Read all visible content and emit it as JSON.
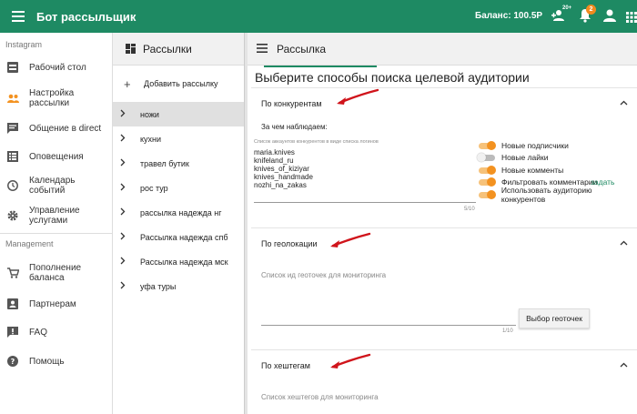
{
  "app": {
    "title": "Бот рассыльщик",
    "balance": "Баланс: 100.5Р",
    "notifications_count": "2",
    "add_user_badge": "20+"
  },
  "sidebar": {
    "section_instagram": "Instagram",
    "items": [
      {
        "label": "Рабочий стол",
        "icon": "dashboard-icon"
      },
      {
        "label": "Настройка рассылки",
        "icon": "people-icon"
      },
      {
        "label": "Общение в direct",
        "icon": "chat-icon"
      },
      {
        "label": "Оповещения",
        "icon": "notification-list-icon"
      },
      {
        "label": "Календарь событий",
        "icon": "clock-icon"
      },
      {
        "label": "Управление услугами",
        "icon": "gear-icon"
      }
    ],
    "section_management": "Management",
    "mgmt_items": [
      {
        "label": "Пополнение баланса",
        "icon": "cart-icon"
      },
      {
        "label": "Партнерам",
        "icon": "contact-icon"
      },
      {
        "label": "FAQ",
        "icon": "faq-icon"
      },
      {
        "label": "Помощь",
        "icon": "help-icon"
      }
    ]
  },
  "mailings": {
    "header": "Рассылки",
    "add_label": "Добавить рассылку",
    "items": [
      "ножи",
      "кухни",
      "травел бутик",
      "рос тур",
      "рассылка надежда нг",
      "Рассылка надежда спб",
      "Рассылка надежда мск",
      "уфа туры"
    ],
    "selected_index": 0
  },
  "main": {
    "header": "Рассылка",
    "title": "Выберите способы поиска целевой аудитории",
    "competitors": {
      "title": "По конкурентам",
      "watch_label": "За чем наблюдаем:",
      "list_hint": "Список аккаунтов конкурентов в виде списка логинов",
      "accounts": "maria.knives\nknifeland_ru\nknives_of_kiziyar\nknives_handmade\nnozhi_na_zakas",
      "counter": "5/10",
      "options": [
        {
          "label": "Новые подписчики",
          "on": true
        },
        {
          "label": "Новые лайки",
          "on": false
        },
        {
          "label": "Новые комменты",
          "on": true
        },
        {
          "label": "Фильтровать комментарии",
          "on": true
        },
        {
          "label": "Использовать аудиторию конкурентов",
          "on": true
        }
      ],
      "filter_link": "задать"
    },
    "geo": {
      "title": "По геолокации",
      "placeholder": "Список ид геоточек для мониторинга",
      "counter": "1/10",
      "button": "Выбор геоточек"
    },
    "hashtags": {
      "title": "По хештегам",
      "placeholder": "Список хештегов для мониторинга"
    }
  },
  "colors": {
    "primary": "#1e8a63",
    "accent": "#f39220",
    "annotation_arrow": "#d0141b"
  }
}
